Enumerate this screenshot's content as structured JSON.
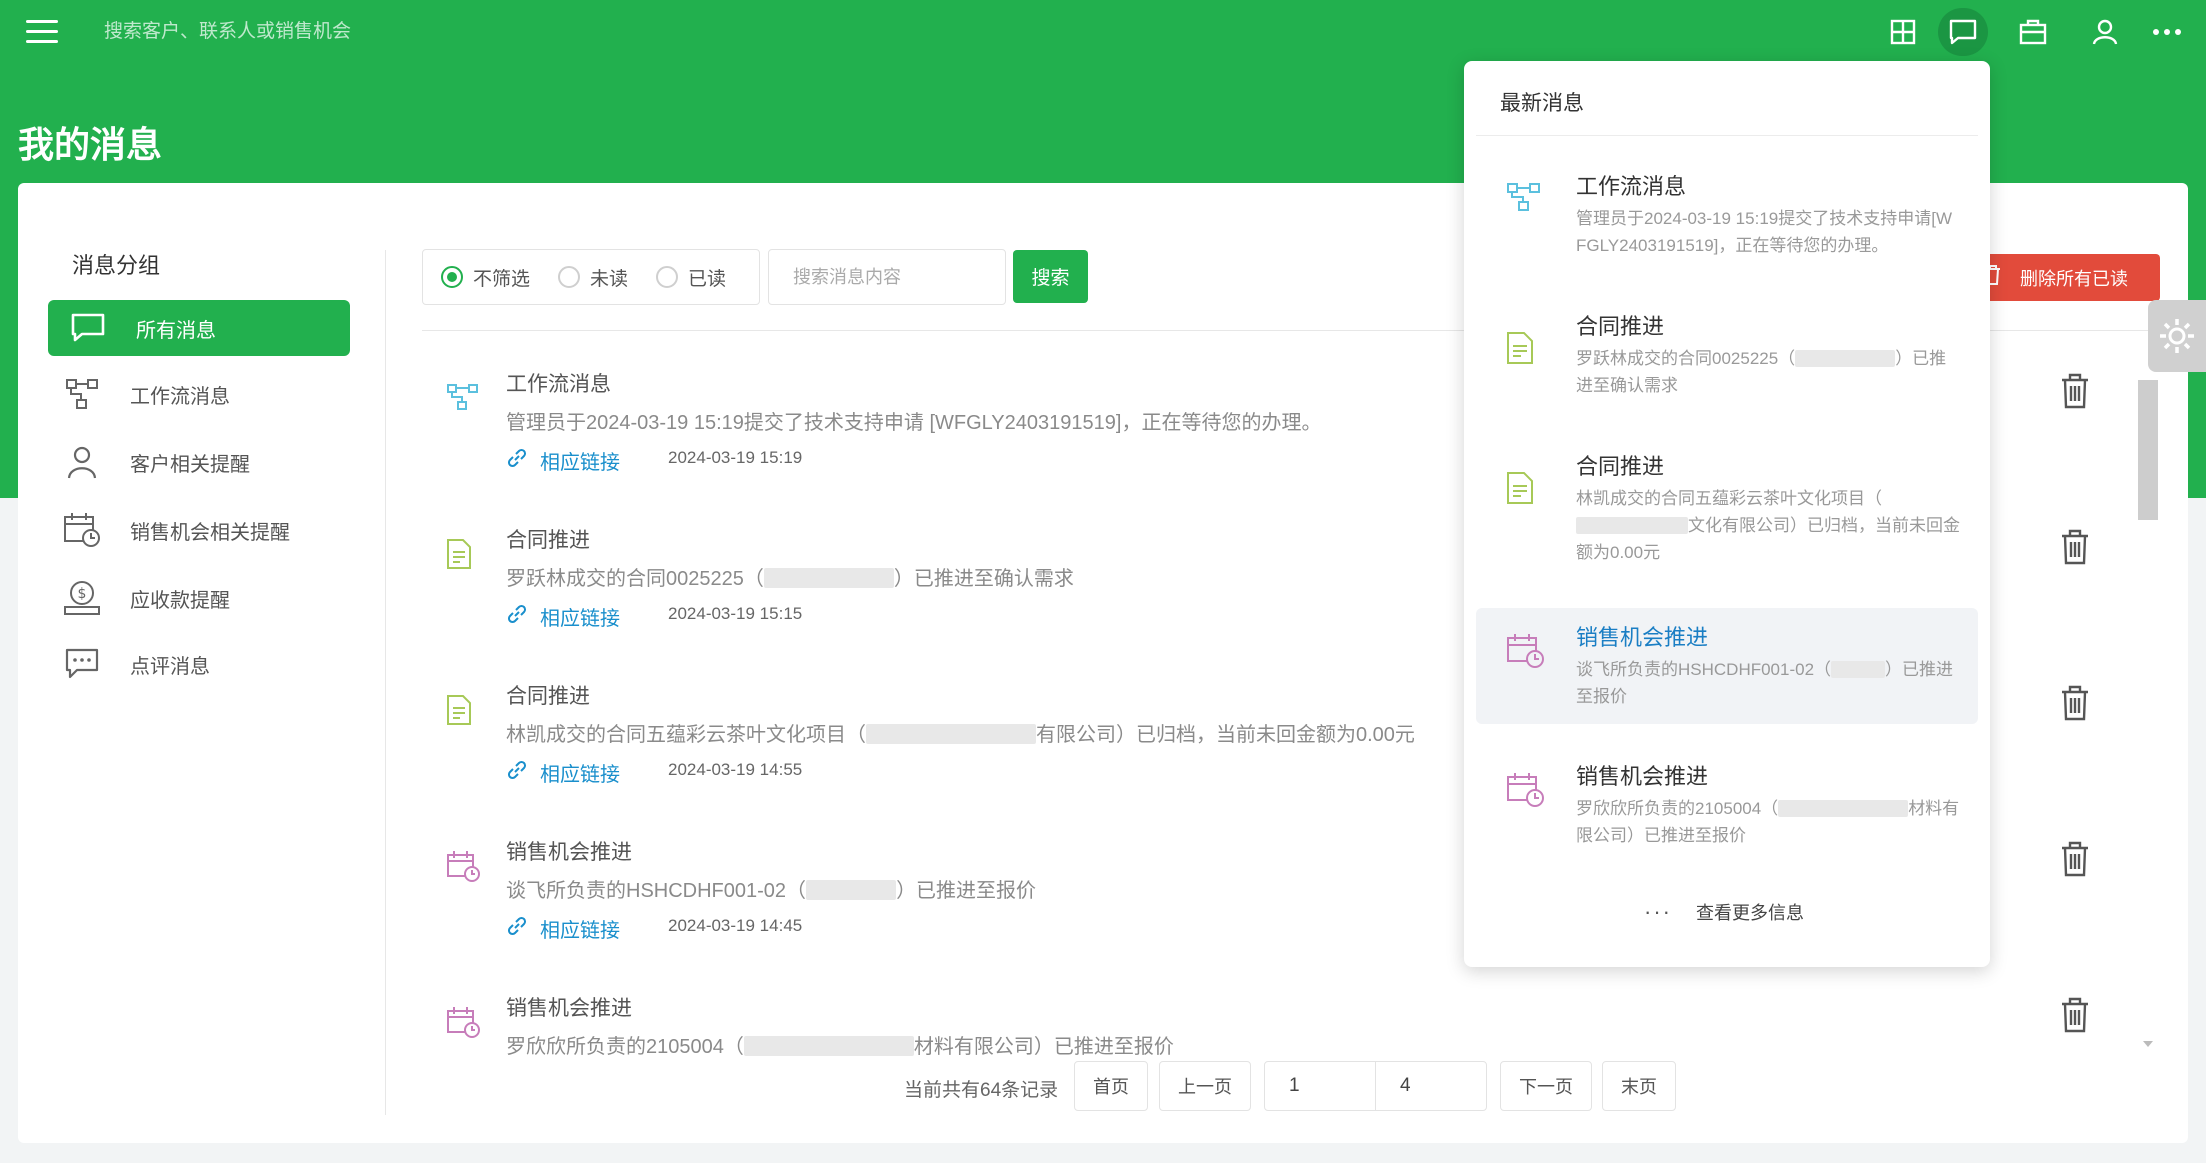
{
  "topbar": {
    "search_placeholder": "搜索客户、联系人或销售机会"
  },
  "page": {
    "title": "我的消息"
  },
  "sidebar": {
    "group_title": "消息分组",
    "items": [
      {
        "label": "所有消息",
        "icon": "chat-icon",
        "active": true
      },
      {
        "label": "工作流消息",
        "icon": "workflow-icon"
      },
      {
        "label": "客户相关提醒",
        "icon": "user-icon"
      },
      {
        "label": "销售机会相关提醒",
        "icon": "calendar-clock-icon"
      },
      {
        "label": "应收款提醒",
        "icon": "money-icon"
      },
      {
        "label": "点评消息",
        "icon": "comment-icon"
      }
    ]
  },
  "filter": {
    "options": [
      "不筛选",
      "未读",
      "已读"
    ],
    "selected": "不筛选",
    "search_placeholder": "搜索消息内容",
    "search_button": "搜索",
    "delete_all_button": "删除所有已读"
  },
  "messages": [
    {
      "title": "工作流消息",
      "body": "管理员于2024-03-19 15:19提交了技术支持申请 [WFGLY2403191519]，正在等待您的办理。",
      "link": "相应链接",
      "time": "2024-03-19 15:19",
      "icon": "workflow-icon"
    },
    {
      "title": "合同推进",
      "body_pre": "罗跃林成交的合同0025225（",
      "body_post": "）已推进至确认需求",
      "link": "相应链接",
      "time": "2024-03-19 15:15",
      "icon": "document-icon"
    },
    {
      "title": "合同推进",
      "body_pre": "林凯成交的合同五蕴彩云茶叶文化项目（",
      "body_post": "有限公司）已归档，当前未回金额为0.00元",
      "link": "相应链接",
      "time": "2024-03-19 14:55",
      "icon": "document-icon"
    },
    {
      "title": "销售机会推进",
      "body_pre": "谈飞所负责的HSHCDHF001-02（",
      "body_post": "）已推进至报价",
      "link": "相应链接",
      "time": "2024-03-19 14:45",
      "icon": "calendar-clock-icon"
    },
    {
      "title": "销售机会推进",
      "body_pre": "罗欣欣所负责的2105004（",
      "body_post": "材料有限公司）已推进至报价",
      "icon": "calendar-clock-icon"
    }
  ],
  "pagination": {
    "summary": "当前共有64条记录",
    "first": "首页",
    "prev": "上一页",
    "current": "1",
    "total": "4",
    "next": "下一页",
    "last": "末页"
  },
  "popup": {
    "title": "最新消息",
    "items": [
      {
        "title": "工作流消息",
        "body": "管理员于2024-03-19 15:19提交了技术支持申请[WFGLY2403191519]，正在等待您的办理。",
        "icon": "workflow-icon"
      },
      {
        "title": "合同推进",
        "body_pre": "罗跃林成交的合同0025225（",
        "body_post": "）已推进至确认需求",
        "icon": "document-icon"
      },
      {
        "title": "合同推进",
        "body_pre": "林凯成交的合同五蕴彩云茶叶文化项目（",
        "body_post": "文化有限公司）已归档，当前未回金额为0.00元",
        "icon": "document-icon"
      },
      {
        "title": "销售机会推进",
        "body_pre": "谈飞所负责的HSHCDHF001-02（",
        "body_post": "）已推进至报价",
        "icon": "calendar-clock-icon",
        "highlighted": true
      },
      {
        "title": "销售机会推进",
        "body_pre": "罗欣欣所负责的2105004（",
        "body_post": "材料有限公司）已推进至报价",
        "icon": "calendar-clock-icon"
      }
    ],
    "more_label": "查看更多信息"
  },
  "colors": {
    "brand_green": "#22b04e",
    "danger_red": "#e24b3b",
    "link_blue": "#1a8fcc",
    "workflow_icon": "#5bc0de",
    "contract_icon": "#a7c957",
    "opportunity_icon": "#c77dba"
  }
}
